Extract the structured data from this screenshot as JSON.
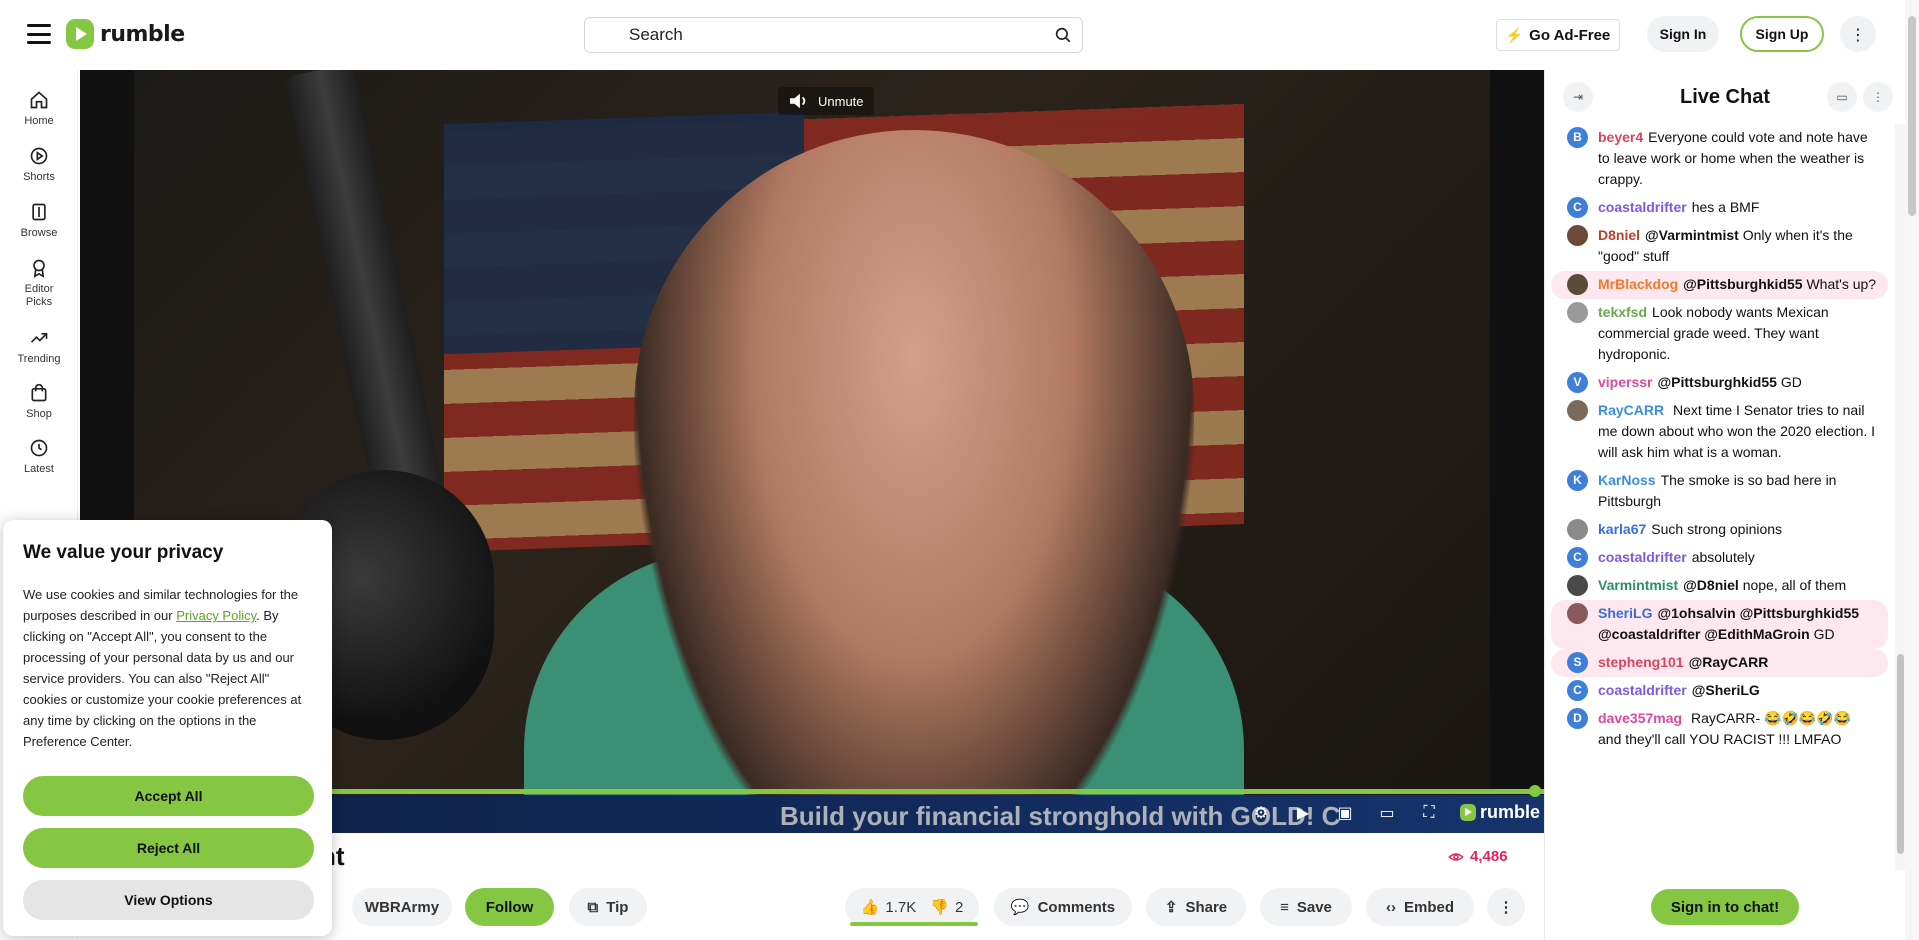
{
  "header": {
    "logo_text": "rumble",
    "search_placeholder": "Search",
    "go_ad_free": "Go Ad-Free",
    "sign_in": "Sign In",
    "sign_up": "Sign Up",
    "brand_color": "#85c742"
  },
  "sidebar": {
    "items": [
      {
        "label": "Home",
        "icon": "home-icon"
      },
      {
        "label": "Shorts",
        "icon": "shorts-icon"
      },
      {
        "label": "Browse",
        "icon": "browse-icon"
      },
      {
        "label": "Editor Picks",
        "icon": "award-icon"
      },
      {
        "label": "Trending",
        "icon": "trending-icon"
      },
      {
        "label": "Shop",
        "icon": "shop-icon"
      },
      {
        "label": "Latest",
        "icon": "clock-icon"
      }
    ]
  },
  "player": {
    "unmute_label": "Unmute",
    "banner_text": "Build your financial stronghold with GOLD! Call Texas B",
    "brand": "rumble",
    "progress_fraction": 0.99
  },
  "video_info": {
    "title_fragment": "nt",
    "views": "4,486",
    "channel": "WBRArmy",
    "follow": "Follow",
    "tip": "Tip",
    "likes": "1.7K",
    "dislikes": "2",
    "comments": "Comments",
    "share": "Share",
    "save": "Save",
    "embed": "Embed"
  },
  "chat": {
    "title": "Live Chat",
    "sign_in": "Sign in to chat!",
    "messages": [
      {
        "user": "beyer4",
        "color": "#d9455f",
        "avatar": "B",
        "avatar_bg": "#3f7fd9",
        "text": "Everyone could vote and note have to leave work or home when the weather is crappy.",
        "highlight": false
      },
      {
        "user": "coastaldrifter",
        "color": "#7a5ae0",
        "avatar": "C",
        "avatar_bg": "#3f7fd9",
        "text": "hes a BMF",
        "highlight": false
      },
      {
        "user": "D8niel",
        "color": "#b8402a",
        "avatar": "",
        "avatar_bg": "#6b4a3a",
        "mention": "@Varmintmist",
        "text": "Only when it's the \"good\" stuff",
        "highlight": false
      },
      {
        "user": "MrBlackdog",
        "color": "#f07a2a",
        "avatar": "",
        "avatar_bg": "#5a4a3a",
        "mention": "@Pittsburghkid55",
        "text": "What's up?",
        "highlight": true
      },
      {
        "user": "tekxfsd",
        "color": "#6aa84f",
        "avatar": "",
        "avatar_bg": "#9a9a9a",
        "text": "Look nobody wants Mexican commercial grade weed. They want hydroponic.",
        "highlight": false
      },
      {
        "user": "viperssr",
        "color": "#d94a9a",
        "avatar": "V",
        "avatar_bg": "#3f7fd9",
        "mention": "@Pittsburghkid55",
        "text": "GD",
        "highlight": false
      },
      {
        "user": "RayCARR",
        "color": "#3a8fd9",
        "avatar": "",
        "avatar_bg": "#7a6a5a",
        "text": " Next time I Senator tries to nail me down about who won the 2020 election. I will ask him what is a woman.",
        "highlight": false
      },
      {
        "user": "KarNoss",
        "color": "#3a8fd9",
        "avatar": "K",
        "avatar_bg": "#3f7fd9",
        "text": "The smoke is so bad here in Pittsburgh",
        "highlight": false
      },
      {
        "user": "karla67",
        "color": "#3a6fd9",
        "avatar": "",
        "avatar_bg": "#8a8a8a",
        "text": "Such strong opinions",
        "highlight": false
      },
      {
        "user": "coastaldrifter",
        "color": "#7a5ae0",
        "avatar": "C",
        "avatar_bg": "#3f7fd9",
        "text": "absolutely",
        "highlight": false
      },
      {
        "user": "Varmintmist",
        "color": "#2a8f6a",
        "avatar": "",
        "avatar_bg": "#4a4a4a",
        "mention": "@D8niel",
        "text": "nope, all of them",
        "highlight": false
      },
      {
        "user": "SheriLG",
        "color": "#3a6fd9",
        "avatar": "",
        "avatar_bg": "#8a5a5a",
        "mention": "@1ohsalvin @Pittsburghkid55 @coastaldrifter @EdithMaGroin",
        "text": "GD",
        "highlight": true
      },
      {
        "user": "stepheng101",
        "color": "#d9455f",
        "avatar": "S",
        "avatar_bg": "#3f7fd9",
        "mention": "@RayCARR",
        "text": "",
        "highlight": true
      },
      {
        "user": "coastaldrifter",
        "color": "#7a5ae0",
        "avatar": "C",
        "avatar_bg": "#3f7fd9",
        "mention": "@SheriLG",
        "text": "",
        "highlight": false
      },
      {
        "user": "dave357mag",
        "color": "#d94a9a",
        "avatar": "D",
        "avatar_bg": "#3f7fd9",
        "text": " RayCARR- 😂🤣😂🤣😂 and they'll call YOU RACIST !!! LMFAO",
        "highlight": false
      }
    ]
  },
  "cookie": {
    "title": "We value your privacy",
    "text_before_link": "We use cookies and similar technologies for the purposes described in our ",
    "link_text": "Privacy Policy",
    "text_after_link": ". By clicking on \"Accept All\", you consent to the processing of your personal data by us and our service providers. You can also \"Reject All\" cookies or customize your cookie preferences at any time by clicking on the options in the Preference Center.",
    "accept_all": "Accept All",
    "reject_all": "Reject All",
    "view_options": "View Options"
  }
}
